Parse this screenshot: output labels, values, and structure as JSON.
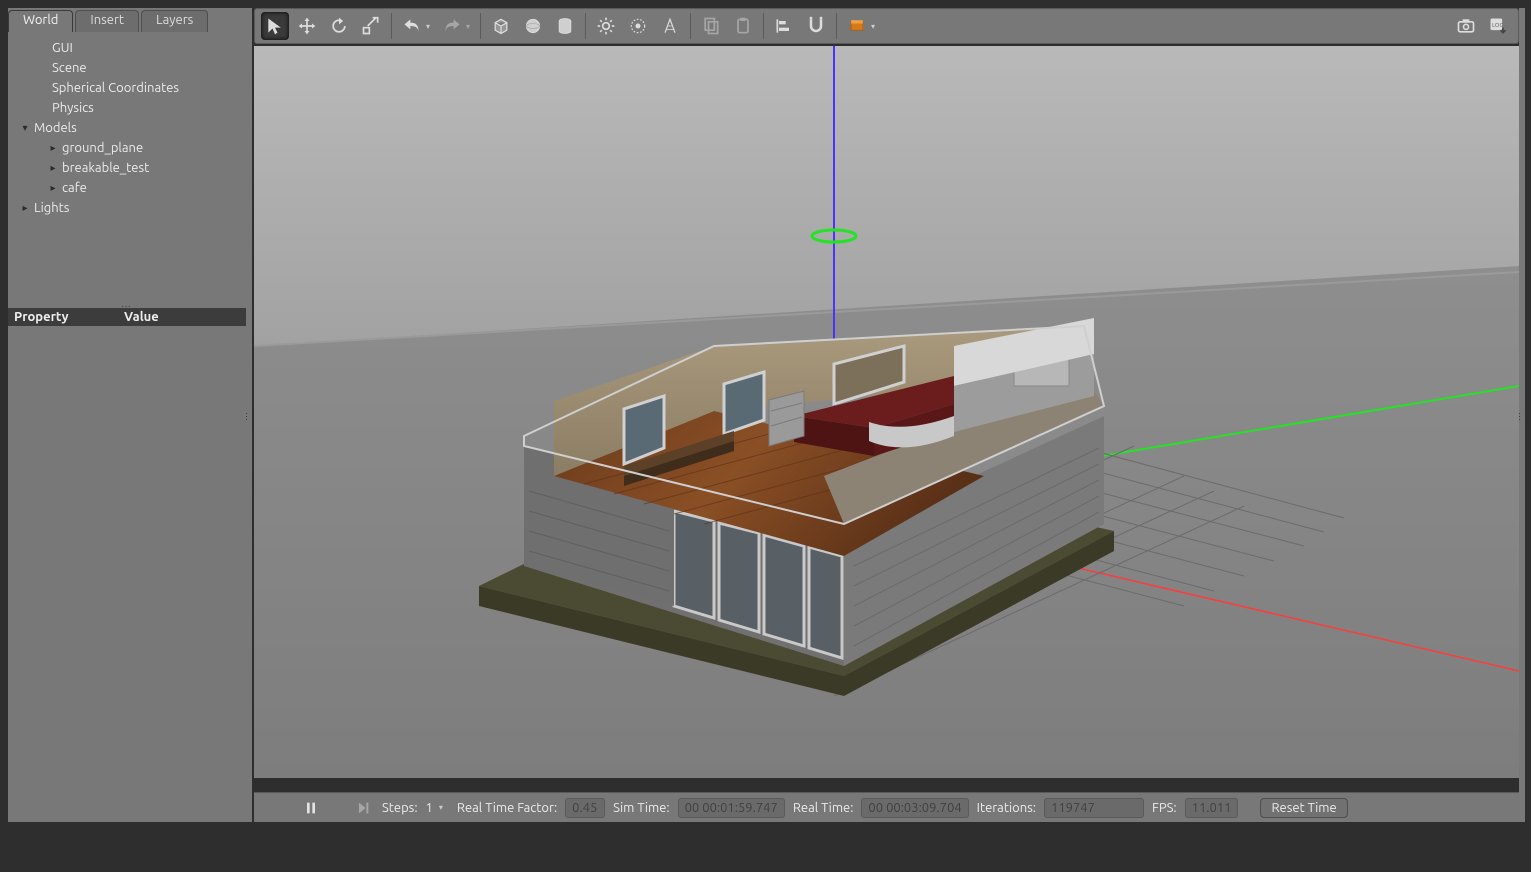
{
  "sidebar": {
    "tabs": [
      "World",
      "Insert",
      "Layers"
    ],
    "active_tab": 0,
    "tree": [
      {
        "label": "GUI",
        "indent": 1,
        "arrow": "none"
      },
      {
        "label": "Scene",
        "indent": 1,
        "arrow": "none"
      },
      {
        "label": "Spherical Coordinates",
        "indent": 1,
        "arrow": "none"
      },
      {
        "label": "Physics",
        "indent": 1,
        "arrow": "none"
      },
      {
        "label": "Models",
        "indent": 0,
        "arrow": "down"
      },
      {
        "label": "ground_plane",
        "indent": 2,
        "arrow": "right"
      },
      {
        "label": "breakable_test",
        "indent": 2,
        "arrow": "right"
      },
      {
        "label": "cafe",
        "indent": 2,
        "arrow": "right"
      },
      {
        "label": "Lights",
        "indent": 0,
        "arrow": "right"
      }
    ],
    "property_header": {
      "col1": "Property",
      "col2": "Value"
    }
  },
  "toolbar": {
    "buttons": [
      "select-arrow",
      "translate",
      "rotate",
      "scale",
      "sep",
      "undo",
      "undo-drop",
      "redo",
      "redo-drop",
      "sep",
      "box",
      "sphere",
      "cylinder",
      "sep",
      "sun-light",
      "point-light",
      "spot-light",
      "sep",
      "copy",
      "paste",
      "sep",
      "align",
      "snap",
      "sep",
      "view-angle"
    ],
    "right_buttons": [
      "screenshot",
      "log-record"
    ]
  },
  "statusbar": {
    "pause_icon": "pause",
    "step_icon": "step",
    "steps_label": "Steps:",
    "steps_value": "1",
    "rtf_label": "Real Time Factor:",
    "rtf_value": "0.45",
    "sim_time_label": "Sim Time:",
    "sim_time_value": "00 00:01:59.747",
    "real_time_label": "Real Time:",
    "real_time_value": "00 00:03:09.704",
    "iterations_label": "Iterations:",
    "iterations_value": "119747",
    "fps_label": "FPS:",
    "fps_value": "11.011",
    "reset_label": "Reset Time"
  }
}
